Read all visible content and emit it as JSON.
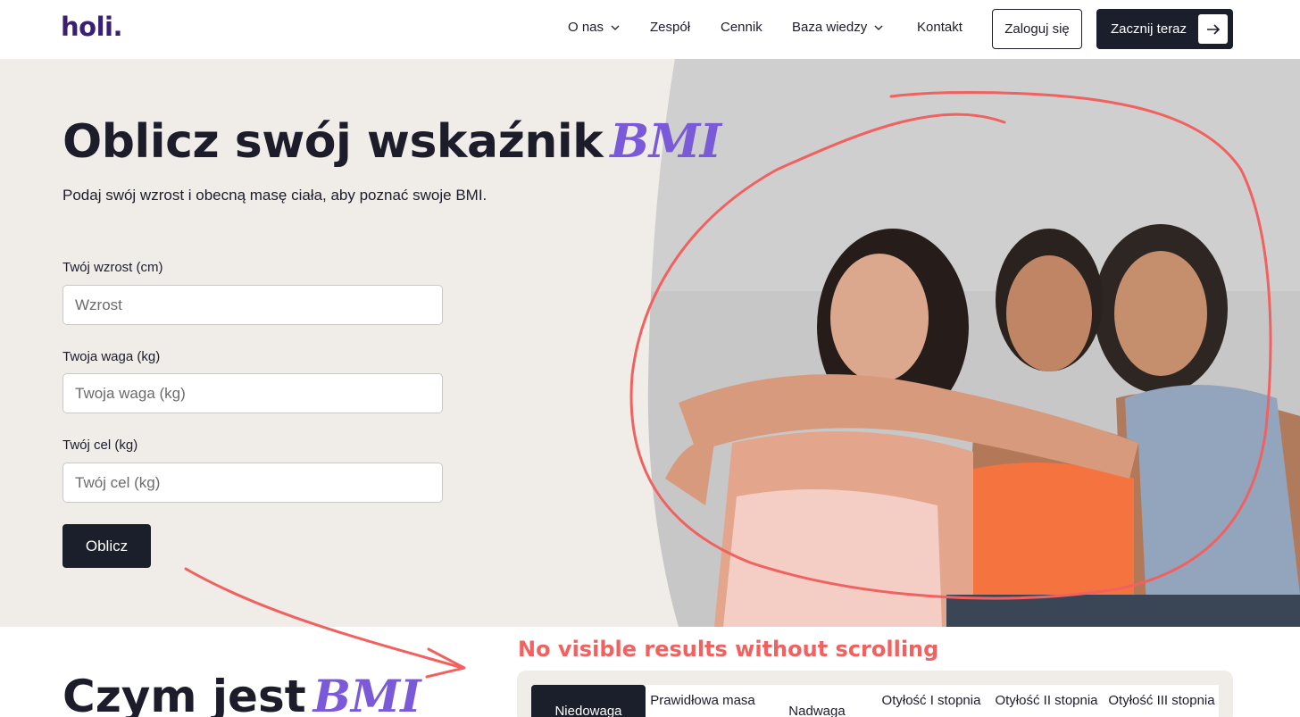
{
  "nav": {
    "logo": "holi.",
    "items": [
      {
        "label": "O nas",
        "dropdown": true
      },
      {
        "label": "Zespół",
        "dropdown": false
      },
      {
        "label": "Cennik",
        "dropdown": false
      },
      {
        "label": "Baza wiedzy",
        "dropdown": true
      },
      {
        "label": "Kontakt",
        "dropdown": false
      }
    ],
    "login_label": "Zaloguj się",
    "start_label": "Zacznij teraz",
    "start_icon": "arrow-right-icon"
  },
  "hero": {
    "title": "Oblicz swój wskaźnik",
    "title_accent": "BMI",
    "subtitle": "Podaj swój wzrost i obecną masę ciała, aby poznać swoje BMI.",
    "fields": [
      {
        "label": "Twój wzrost (cm)",
        "placeholder": "Wzrost",
        "value": ""
      },
      {
        "label": "Twoja waga (kg)",
        "placeholder": "Twoja waga (kg)",
        "value": ""
      },
      {
        "label": "Twój cel (kg)",
        "placeholder": "Twój cel (kg)",
        "value": ""
      }
    ],
    "calc_label": "Oblicz",
    "photo": "three-smiling-women-photo"
  },
  "bottom": {
    "title": "Czym jest",
    "title_accent": "BMI",
    "tabs": [
      {
        "label": "Niedowaga",
        "active": true
      },
      {
        "label": "Prawidłowa masa",
        "active": false
      },
      {
        "label": "Nadwaga",
        "active": false
      },
      {
        "label": "Otyłość I stopnia",
        "active": false
      },
      {
        "label": "Otyłość II stopnia",
        "active": false
      },
      {
        "label": "Otyłość III stopnia",
        "active": false
      }
    ]
  },
  "annotation": {
    "text": "No visible results without scrolling",
    "color": "#f0615f"
  },
  "colors": {
    "brand": "#3a1f73",
    "accent": "#7a5ad8",
    "dark": "#1b1e2b",
    "hero_bg": "#f0ede8"
  }
}
